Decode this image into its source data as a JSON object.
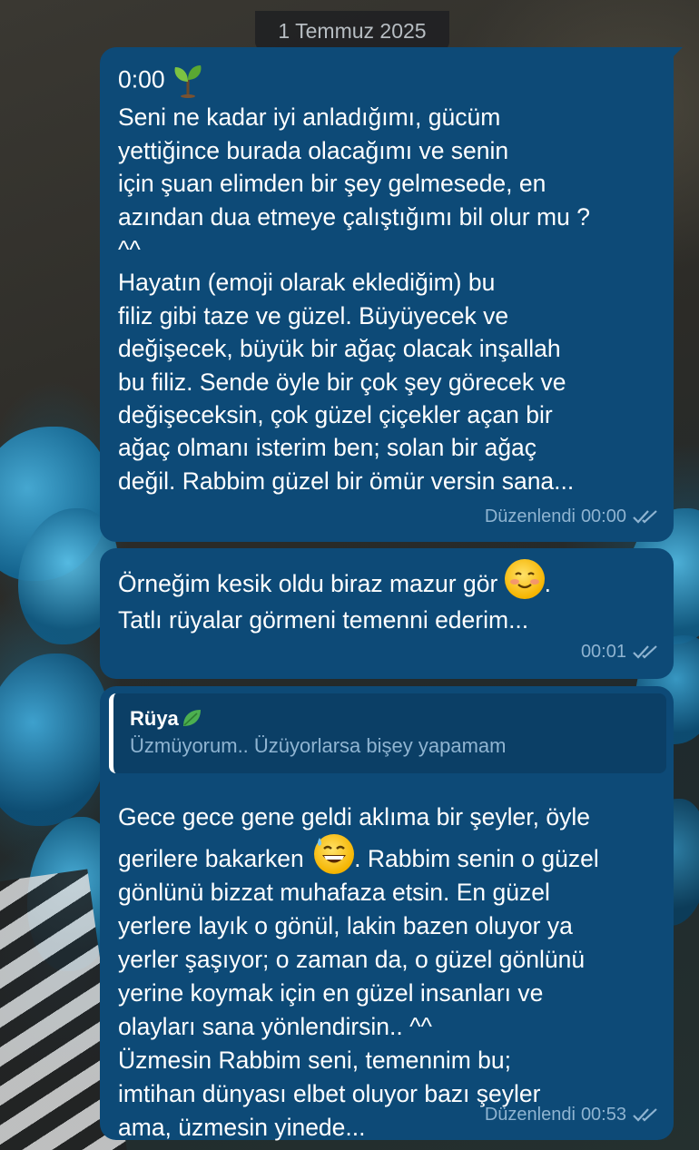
{
  "date_chip": "1 Temmuz 2025",
  "messages": [
    {
      "lines": [
        "0:00",
        "Seni ne kadar iyi anladığımı, gücüm",
        "yettiğince burada olacağımı ve senin",
        "için şuan elimden bir şey gelmesede, en",
        "azından dua etmeye çalıştığımı bil olur mu ?",
        "^^",
        "Hayatın (emoji olarak eklediğim) bu",
        "filiz gibi taze ve güzel. Büyüyecek ve",
        "değişecek, büyük bir ağaç olacak inşallah",
        "bu filiz. Sende öyle bir çok şey görecek ve",
        "değişeceksin, çok güzel çiçekler açan bir",
        "ağaç olmanı isterim ben; solan bir ağaç",
        "değil. Rabbim güzel bir ömür versin sana..."
      ],
      "emoji_after_first_line": "seedling",
      "edited_label": "Düzenlendi",
      "time": "00:00",
      "status": "read"
    },
    {
      "lines": [
        "Örneğim kesik oldu biraz mazur gör",
        ".",
        "Tatlı rüyalar görmeni temenni ederim..."
      ],
      "emoji": "smiling-face-with-blush",
      "time": "00:01",
      "status": "read"
    },
    {
      "reply": {
        "name": "Rüya",
        "name_emoji": "leaf",
        "text": "Üzmüyorum.. Üzüyorlarsa bişey yapamam"
      },
      "lines": [
        "Gece gece gene geldi aklıma bir şeyler, öyle",
        "gerilere bakarken",
        ". Rabbim senin o güzel",
        "gönlünü bizzat muhafaza etsin. En güzel",
        "yerlere layık o gönül, lakin bazen oluyor ya",
        "yerler şaşıyor; o zaman da, o güzel gönlünü",
        "yerine koymak için en güzel insanları ve",
        "olayları sana yönlendirsin.. ^^",
        "Üzmesin Rabbim seni, temennim bu;",
        "imtihan dünyası elbet oluyor bazı şeyler",
        "ama, üzmesin yinede..."
      ],
      "emoji": "grinning-face-with-sweat",
      "edited_label": "Düzenlendi",
      "time": "00:53",
      "status": "read"
    }
  ],
  "colors": {
    "bubble": "#0d4a77",
    "reply_bg": "#0b3f66",
    "meta": "#8fb4d1",
    "text": "#ffffff"
  }
}
